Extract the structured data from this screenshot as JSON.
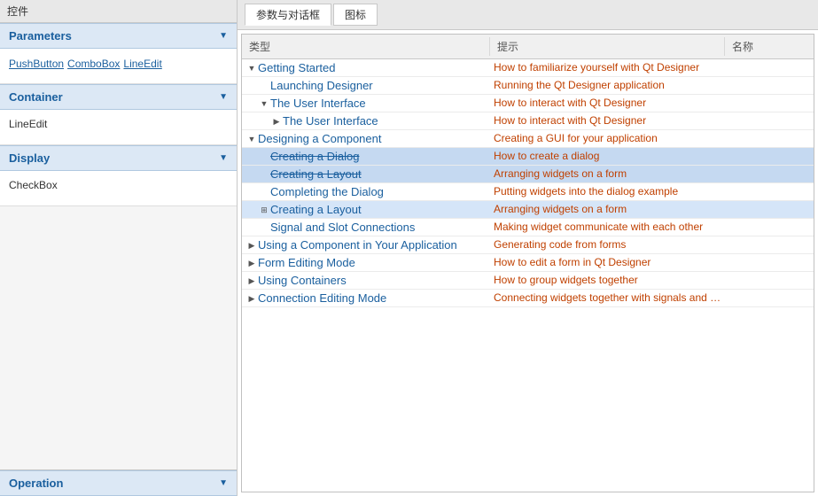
{
  "leftPanel": {
    "title": "控件",
    "sections": [
      {
        "id": "parameters",
        "label": "Parameters",
        "widgets": [
          "PushButton",
          "ComboBox",
          "LineEdit"
        ],
        "content_items": []
      },
      {
        "id": "container",
        "label": "Container",
        "widgets": [],
        "content_items": [
          "LineEdit"
        ]
      },
      {
        "id": "display",
        "label": "Display",
        "widgets": [],
        "content_items": [
          "CheckBox"
        ]
      },
      {
        "id": "operation",
        "label": "Operation",
        "widgets": [],
        "content_items": []
      }
    ]
  },
  "rightPanel": {
    "title": "参数与对话框",
    "tabs": [
      "参数与对话框",
      "图标"
    ],
    "activeTab": 0,
    "tableHeaders": {
      "type": "类型",
      "hint": "提示",
      "name": "名称"
    },
    "rows": [
      {
        "id": 1,
        "level": 0,
        "expander": "expanded",
        "text": "Getting Started",
        "hint": "How to familiarize yourself with Qt Designer",
        "name": "",
        "selected": false,
        "link": true
      },
      {
        "id": 2,
        "level": 1,
        "expander": "leaf",
        "text": "Launching Designer",
        "hint": "Running the Qt Designer application",
        "name": "",
        "selected": false,
        "link": true
      },
      {
        "id": 3,
        "level": 1,
        "expander": "expanded",
        "text": "The User Interface",
        "hint": "How to interact with Qt Designer",
        "name": "",
        "selected": false,
        "link": true
      },
      {
        "id": 4,
        "level": 2,
        "expander": "leaf",
        "text": "The User Interface",
        "hint": "How to interact with Qt Designer",
        "name": "",
        "selected": false,
        "link": true
      },
      {
        "id": 5,
        "level": 0,
        "expander": "expanded",
        "text": "Designing a Component",
        "hint": "Creating a GUI for your application",
        "name": "",
        "selected": false,
        "link": true
      },
      {
        "id": 6,
        "level": 1,
        "expander": "leaf",
        "text": "Creating a Dialog",
        "hint": "How to create a dialog",
        "name": "",
        "selected": true,
        "link": true,
        "strikethrough": true
      },
      {
        "id": 7,
        "level": 1,
        "expander": "leaf",
        "text": "Creating a Layout",
        "hint": "Arranging widgets on a form",
        "name": "",
        "selected": true,
        "link": true,
        "strikethrough": true
      },
      {
        "id": 8,
        "level": 1,
        "expander": "leaf",
        "text": "Completing the Dialog",
        "hint": "Putting widgets into the dialog example",
        "name": "",
        "selected": false,
        "link": true
      },
      {
        "id": 9,
        "level": 1,
        "expander": "leaf",
        "text": "Creating a Layout",
        "hint": "Arranging widgets on a form",
        "name": "",
        "selected": true,
        "link": true
      },
      {
        "id": 10,
        "level": 1,
        "expander": "leaf",
        "text": "Signal and Slot Connections",
        "hint": "Making widget communicate with each other",
        "name": "",
        "selected": false,
        "link": true
      },
      {
        "id": 11,
        "level": 0,
        "expander": "collapsed",
        "text": "Using a Component in Your Application",
        "hint": "Generating code from forms",
        "name": "",
        "selected": false,
        "link": true
      },
      {
        "id": 12,
        "level": 0,
        "expander": "collapsed",
        "text": "Form Editing Mode",
        "hint": "How to edit a form in Qt Designer",
        "name": "",
        "selected": false,
        "link": true
      },
      {
        "id": 13,
        "level": 0,
        "expander": "collapsed",
        "text": "Using Containers",
        "hint": "How to group widgets together",
        "name": "",
        "selected": false,
        "link": true
      },
      {
        "id": 14,
        "level": 0,
        "expander": "collapsed",
        "text": "Connection Editing Mode",
        "hint": "Connecting widgets together with signals and slots",
        "name": "",
        "selected": false,
        "link": true
      }
    ]
  }
}
